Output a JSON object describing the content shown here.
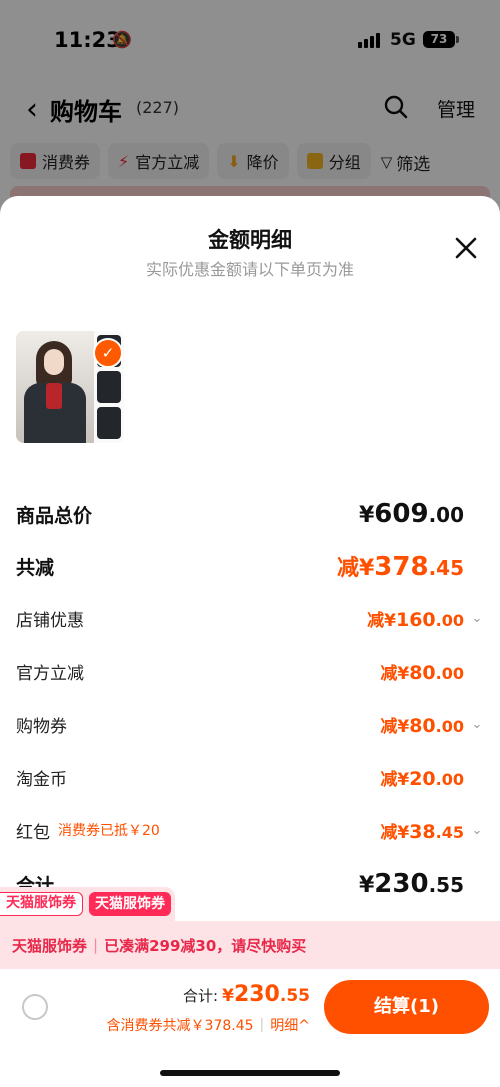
{
  "status_bar": {
    "time": "11:23",
    "network": "5G",
    "battery": "73"
  },
  "nav": {
    "back_glyph": "‹",
    "title": "购物车",
    "count": "(227)",
    "manage": "管理"
  },
  "filters": [
    {
      "label": "消费券",
      "icon": "coupon-icon",
      "color": "#e8283a"
    },
    {
      "label": "官方立减",
      "icon": "lightning-icon",
      "color": "#e8283a"
    },
    {
      "label": "降价",
      "icon": "down-arrow-icon",
      "color": "#f0a020"
    },
    {
      "label": "分组",
      "icon": "folder-icon",
      "color": "#f0b020"
    }
  ],
  "filter_screen": {
    "label": "筛选",
    "icon": "funnel-icon"
  },
  "sheet": {
    "title": "金额明细",
    "subtitle": "实际优惠金额请以下单页为准",
    "close_glyph": "✕",
    "check_glyph": "✓"
  },
  "rows": {
    "subtotal": {
      "label": "商品总价",
      "prefix": "¥",
      "int": "609",
      "dec": ".00"
    },
    "total_discount": {
      "label": "共减",
      "prefix": "减¥",
      "int": "378",
      "dec": ".45"
    },
    "store_discount": {
      "label": "店铺优惠",
      "prefix": "减¥",
      "int": "160",
      "dec": ".00"
    },
    "official_discount": {
      "label": "官方立减",
      "prefix": "减¥",
      "int": "80",
      "dec": ".00"
    },
    "shopping_coupon": {
      "label": "购物券",
      "prefix": "减¥",
      "int": "80",
      "dec": ".00"
    },
    "taojinbi": {
      "label": "淘金币",
      "prefix": "减¥",
      "int": "20",
      "dec": ".00"
    },
    "red_packet": {
      "label": "红包",
      "note": "消费券已抵￥20",
      "prefix": "减¥",
      "int": "38",
      "dec": ".45"
    },
    "total": {
      "label": "合计",
      "prefix": "¥",
      "int": "230",
      "dec": ".55"
    }
  },
  "chevron_glyph": "⌄",
  "coupon_tags": {
    "outline": "天猫服饰券",
    "filled": "天猫服饰券"
  },
  "promo": {
    "tag": "天猫服饰券",
    "sep": "|",
    "text": "已凑满299减30，请尽快购买"
  },
  "footer": {
    "total_label": "合计:",
    "prefix": "¥",
    "int": "230",
    "dec": ".55",
    "sub_text": "含消费券共减￥378.45",
    "sub_sep": "|",
    "detail": "明细",
    "detail_glyph": "^",
    "checkout": "结算(1)"
  },
  "colors": {
    "accent": "#ff5000",
    "promo_red": "#ff2a55"
  }
}
